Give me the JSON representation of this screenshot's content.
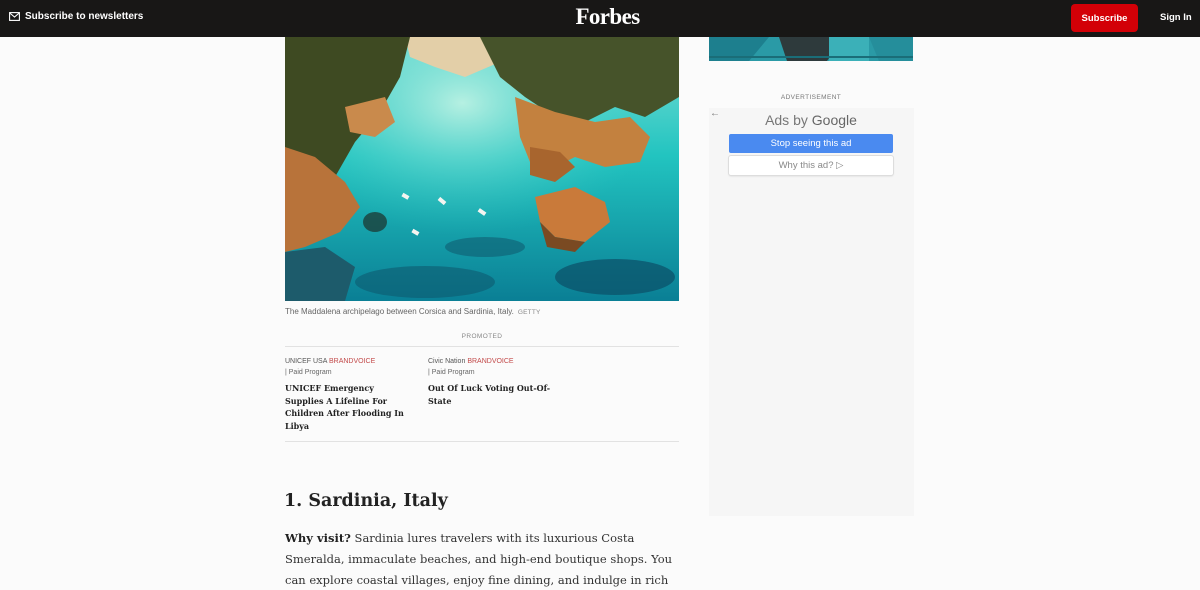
{
  "topbar": {
    "newsletter_label": "Subscribe to newsletters",
    "logo": "Forbes",
    "subscribe_label": "Subscribe",
    "signin_label": "Sign In"
  },
  "hero": {
    "caption": "The Maddalena archipelago between Corsica and Sardinia, Italy.",
    "credit": "GETTY"
  },
  "promoted": {
    "label": "PROMOTED",
    "items": [
      {
        "source": "UNICEF USA",
        "brand": "BRANDVOICE",
        "paid": "| Paid Program",
        "title": "UNICEF Emergency Supplies A Lifeline For Children After Flooding In Libya"
      },
      {
        "source": "Civic Nation",
        "brand": "BRANDVOICE",
        "paid": "| Paid Program",
        "title": "Out Of Luck Voting Out-Of-State"
      }
    ]
  },
  "article": {
    "heading": "1. Sardinia, Italy",
    "lead": "Why visit?",
    "body": " Sardinia lures travelers with its luxurious Costa Smeralda, immaculate beaches, and high-end boutique shops. You can explore coastal villages, enjoy fine dining, and indulge in rich local experiences."
  },
  "sidebar": {
    "advertisement_label": "ADVERTISEMENT",
    "ads_by": "Ads by",
    "google": "Google",
    "stop_label": "Stop seeing this ad",
    "why_label": "Why this ad? ▷",
    "back_icon": "←"
  },
  "colors": {
    "topbar_bg": "#181716",
    "subscribe_red": "#d30007",
    "brandvoice": "#c34a4a",
    "stop_btn": "#4a8af0"
  }
}
